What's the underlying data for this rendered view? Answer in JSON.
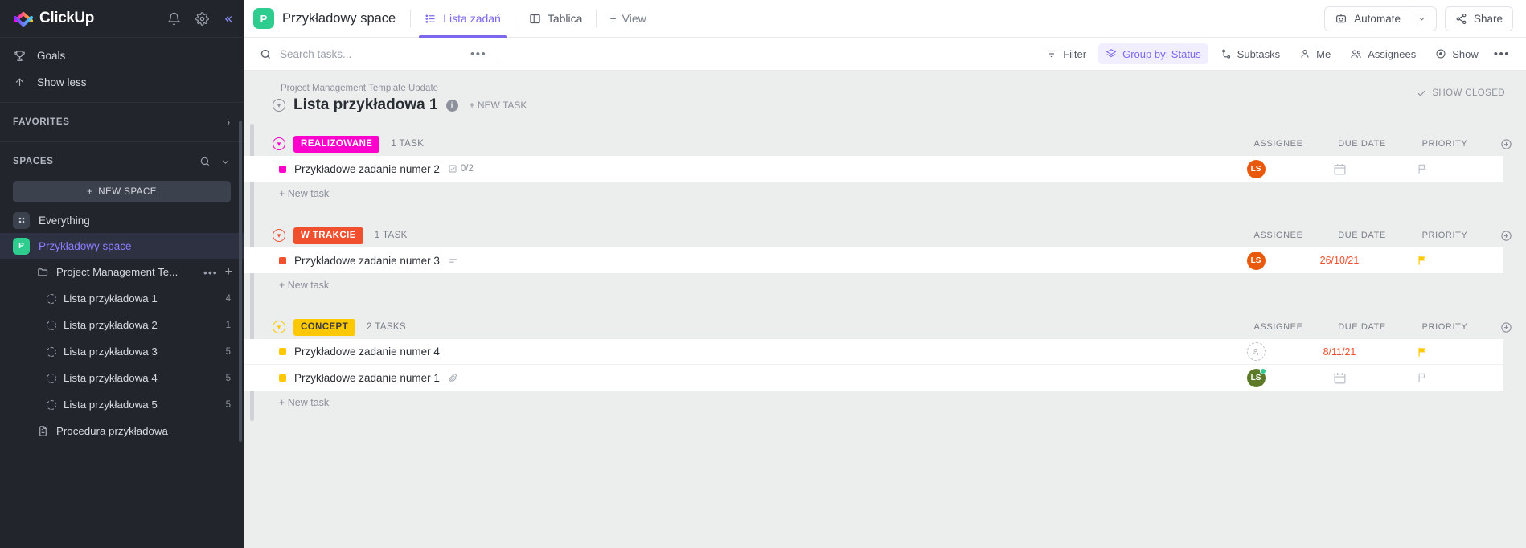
{
  "sidebar": {
    "brand": "ClickUp",
    "top_icons": [
      {
        "name": "notifications-icon",
        "glyph": "bell"
      },
      {
        "name": "settings-icon",
        "glyph": "gear"
      },
      {
        "name": "collapse-sidebar-icon",
        "glyph": "«"
      }
    ],
    "nav": [
      {
        "label": "Goals",
        "icon": "trophy-icon"
      },
      {
        "label": "Show less",
        "icon": "arrow-up-icon"
      }
    ],
    "favorites": {
      "label": "FAVORITES",
      "arrow": "›"
    },
    "spaces": {
      "label": "SPACES",
      "new_space": "NEW SPACE",
      "items": [
        {
          "label": "Everything",
          "avatar": "",
          "type": "everything"
        },
        {
          "label": "Przykładowy space",
          "avatar": "P",
          "type": "space",
          "active": true
        }
      ],
      "folder": {
        "label": "Project Management Te...",
        "dots": "•••",
        "plus": "+"
      },
      "lists": [
        {
          "label": "Lista przykładowa 1",
          "count": "4"
        },
        {
          "label": "Lista przykładowa 2",
          "count": "1"
        },
        {
          "label": "Lista przykładowa 3",
          "count": "5"
        },
        {
          "label": "Lista przykładowa 4",
          "count": "5"
        },
        {
          "label": "Lista przykładowa 5",
          "count": "5"
        }
      ],
      "doc": {
        "label": "Procedura przykładowa"
      }
    }
  },
  "topbar": {
    "space_avatar": "P",
    "space_name": "Przykładowy space",
    "tabs": [
      {
        "label": "Lista zadań",
        "icon": "list-icon",
        "active": true
      },
      {
        "label": "Tablica",
        "icon": "board-icon",
        "active": false
      }
    ],
    "add_view": "View",
    "automate": "Automate",
    "share": "Share"
  },
  "toolbar": {
    "search_placeholder": "Search tasks...",
    "search_value": "",
    "dots": "•••",
    "items": [
      {
        "label": "Filter",
        "icon": "filter-icon",
        "highlight": false
      },
      {
        "label": "Group by: Status",
        "icon": "layers-icon",
        "highlight": true
      },
      {
        "label": "Subtasks",
        "icon": "subtask-icon",
        "highlight": false
      },
      {
        "label": "Me",
        "icon": "person-icon",
        "highlight": false
      },
      {
        "label": "Assignees",
        "icon": "people-icon",
        "highlight": false
      },
      {
        "label": "Show",
        "icon": "eye-icon",
        "highlight": false
      }
    ],
    "more": "•••"
  },
  "list": {
    "breadcrumb": "Project Management Template Update",
    "title": "Lista przykładowa 1",
    "new_task": "+ NEW TASK",
    "show_closed": "SHOW CLOSED",
    "columns": {
      "assignee": "ASSIGNEE",
      "due_date": "DUE DATE",
      "priority": "PRIORITY"
    },
    "add_column": "+",
    "new_task_row": "+ New task",
    "groups": [
      {
        "status": "REALIZOWANE",
        "color": "#ff00cc",
        "count": "1 TASK",
        "tasks": [
          {
            "name": "Przykładowe zadanie numer 2",
            "dot_color": "#ff00cc",
            "checklist": "0/2",
            "has_checklist": true,
            "has_description": false,
            "has_attachment": false,
            "assignee": {
              "initials": "LS",
              "color": "#e8590c",
              "online": false,
              "empty": false
            },
            "due_date": "",
            "due_color": "#b9bec6",
            "priority_color": "#b9bec6"
          }
        ]
      },
      {
        "status": "W TRAKCIE",
        "color": "#f1502f",
        "count": "1 TASK",
        "tasks": [
          {
            "name": "Przykładowe zadanie numer 3",
            "dot_color": "#f1502f",
            "checklist": "",
            "has_checklist": false,
            "has_description": true,
            "has_attachment": false,
            "assignee": {
              "initials": "LS",
              "color": "#e8590c",
              "online": false,
              "empty": false
            },
            "due_date": "26/10/21",
            "due_color": "#f1502f",
            "priority_color": "#ffc800"
          }
        ]
      },
      {
        "status": "CONCEPT",
        "color": "#ffc800",
        "count": "2 TASKS",
        "tasks": [
          {
            "name": "Przykładowe zadanie numer 4",
            "dot_color": "#ffc800",
            "checklist": "",
            "has_checklist": false,
            "has_description": false,
            "has_attachment": false,
            "assignee": {
              "initials": "",
              "color": "",
              "online": false,
              "empty": true
            },
            "due_date": "8/11/21",
            "due_color": "#f1502f",
            "priority_color": "#ffc800"
          },
          {
            "name": "Przykładowe zadanie numer 1",
            "dot_color": "#ffc800",
            "checklist": "",
            "has_checklist": false,
            "has_description": false,
            "has_attachment": true,
            "assignee": {
              "initials": "LS",
              "color": "#5c7a29",
              "online": true,
              "empty": false
            },
            "due_date": "",
            "due_color": "#b9bec6",
            "priority_color": "#b9bec6"
          }
        ]
      }
    ]
  }
}
